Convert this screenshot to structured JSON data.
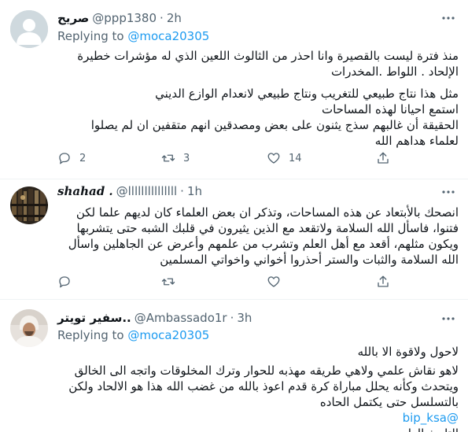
{
  "tweets": [
    {
      "name": "صريح",
      "handle": "@ppp1380",
      "dot": "·",
      "time": "2h",
      "replying_prefix": "Replying to",
      "replying_to": "@moca20305",
      "lines": [
        "منذ  فترة ليست بالقصيرة وانا احذر من الثالوث اللعين الذي له مؤشرات خطيرة",
        "الإلحاد . اللواط .المخدرات",
        "مثل هذا نتاج طبيعي للتغريب ونتاج طبيعي لانعدام الوازع الديني",
        "استمع احيانا لهذه المساحات",
        "الحقيقة أن غالبهم سذج يثنون على بعض ومصدقين انهم متقفين ان لم يصلوا",
        "لعلماء هداهم الله"
      ],
      "stats": {
        "replies": "2",
        "retweets": "3",
        "likes": "14"
      }
    },
    {
      "name": "𝒔𝒉𝒂𝒉𝒂𝒅 .",
      "handle": "@lllllllllllllll",
      "dot": "·",
      "time": "1h",
      "lines": [
        "انصحك بالأبتعاد عن هذه المساحات، وتذكر ان بعض العلماء كان لديهم علما لكن",
        "فتنوا، فاسأل الله السلامة ولاتقعد مع الذين يثيرون في قلبك الشبه حتى يتشربها",
        "ويكون مثلهم، أقعد مع أهل العلم وتشرب من علمهم وأعرض عن الجاهلين واسأل",
        "الله السلامة والثبات والستر أحذروا أخواني واخواتي المسلمين"
      ],
      "stats": {
        "replies": "",
        "retweets": "",
        "likes": ""
      }
    },
    {
      "name": "سفير تويتر..",
      "handle": "@Ambassado1r",
      "dot": "·",
      "time": "3h",
      "replying_prefix": "Replying to",
      "replying_to": "@moca20305",
      "lines": [
        "لاحول ولاقوة الا بالله",
        "لاهو نقاش علمي ولاهي طريقه مهذبه للحوار وترك المخلوقات واتجه الى الخالق",
        "ويتحدث وكأنه يحلل مباراة كرة قدم اعوذ بالله من غضب الله هذا هو الالحاد ولكن",
        "بالتسلسل حتى يكتمل الحاده"
      ],
      "mention": "@bip_ksa",
      "cut_line": "التاريخ العلمي"
    }
  ],
  "colors": {
    "accent": "#1d9bf0",
    "secondary": "#536471",
    "text": "#0f1419",
    "divider": "#eff3f4"
  },
  "icons": [
    "default-avatar-icon",
    "more-icon",
    "reply-icon",
    "retweet-icon",
    "like-icon",
    "share-icon"
  ]
}
